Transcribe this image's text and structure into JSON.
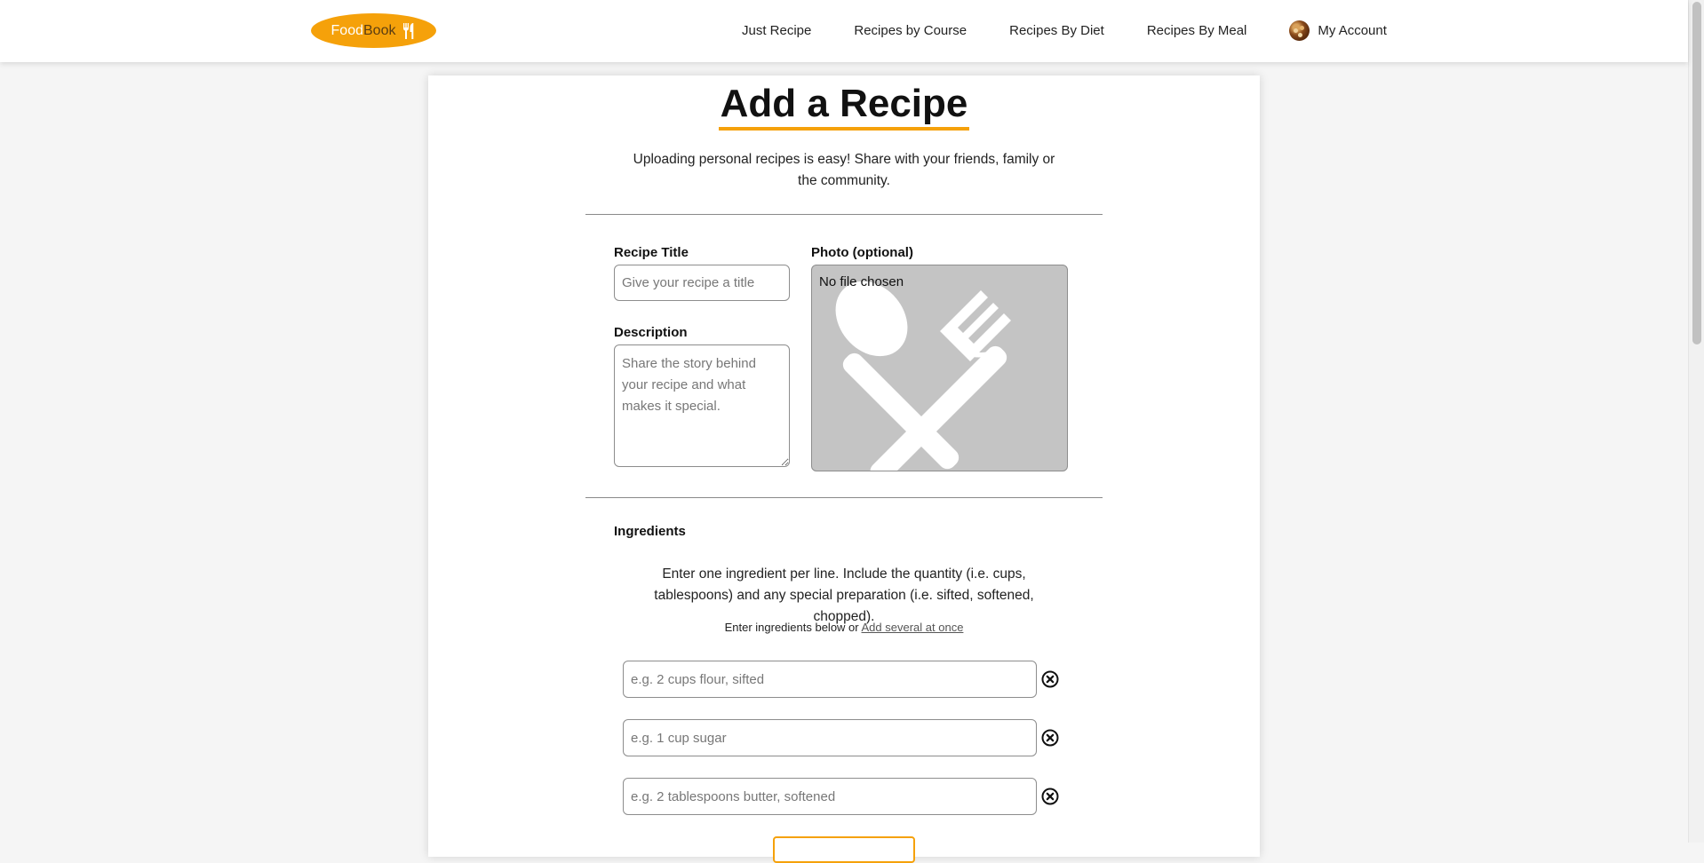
{
  "brand": {
    "food": "Food",
    "book": "Book",
    "icon": "utensils-icon",
    "color": "#f5a10a"
  },
  "nav": {
    "links": [
      "Just Recipe",
      "Recipes by Course",
      "Recipes By Diet",
      "Recipes By Meal"
    ],
    "account_label": "My Account"
  },
  "page": {
    "title": "Add a Recipe",
    "intro": "Uploading personal recipes is easy! Share with your friends, family or the community."
  },
  "form": {
    "title_label": "Recipe Title",
    "title_placeholder": "Give your recipe a title",
    "title_value": "",
    "description_label": "Description",
    "description_placeholder": "Share the story behind your recipe and what makes it special.",
    "description_value": "",
    "photo_label": "Photo (optional)",
    "photo_status": "No file chosen",
    "photo_icon": "utensils-icon"
  },
  "ingredients": {
    "label": "Ingredients",
    "note": "Enter one ingredient per line. Include the quantity (i.e. cups, tablespoons) and any special preparation (i.e. sifted, softened, chopped).",
    "sub_prefix": "Enter ingredients below or",
    "sub_link": "Add several at once",
    "items": [
      {
        "placeholder": "e.g. 2 cups flour, sifted",
        "value": ""
      },
      {
        "placeholder": "e.g. 1 cup sugar",
        "value": ""
      },
      {
        "placeholder": "e.g. 2 tablespoons butter, softened",
        "value": ""
      }
    ],
    "remove_icon": "remove-circle-icon"
  }
}
